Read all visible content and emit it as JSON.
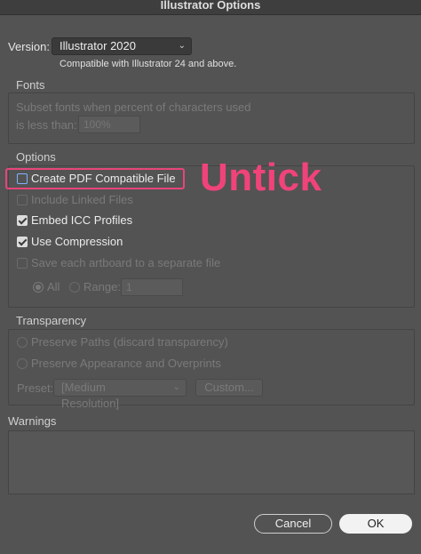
{
  "window": {
    "title": "Illustrator Options"
  },
  "version": {
    "label": "Version:",
    "selected": "Illustrator 2020",
    "compat_note": "Compatible with Illustrator 24 and above."
  },
  "fonts": {
    "heading": "Fonts",
    "subset_line1": "Subset fonts when percent of characters used",
    "subset_line2": "is less than:",
    "subset_value": "100%"
  },
  "options": {
    "heading": "Options",
    "items": [
      {
        "label": "Create PDF Compatible File",
        "checked": false,
        "enabled": true
      },
      {
        "label": "Include Linked Files",
        "checked": false,
        "enabled": false
      },
      {
        "label": "Embed ICC Profiles",
        "checked": true,
        "enabled": true
      },
      {
        "label": "Use Compression",
        "checked": true,
        "enabled": true
      },
      {
        "label": "Save each artboard to a separate file",
        "checked": false,
        "enabled": false
      }
    ],
    "all_label": "All",
    "range_label": "Range:",
    "range_value": "1"
  },
  "transparency": {
    "heading": "Transparency",
    "preserve_paths": "Preserve Paths (discard transparency)",
    "preserve_appearance": "Preserve Appearance and Overprints",
    "preset_label": "Preset:",
    "preset_value": "[Medium Resolution]",
    "custom_button": "Custom..."
  },
  "warnings": {
    "heading": "Warnings"
  },
  "buttons": {
    "cancel": "Cancel",
    "ok": "OK"
  },
  "annotation": {
    "text": "Untick",
    "color": "#f0437a"
  }
}
